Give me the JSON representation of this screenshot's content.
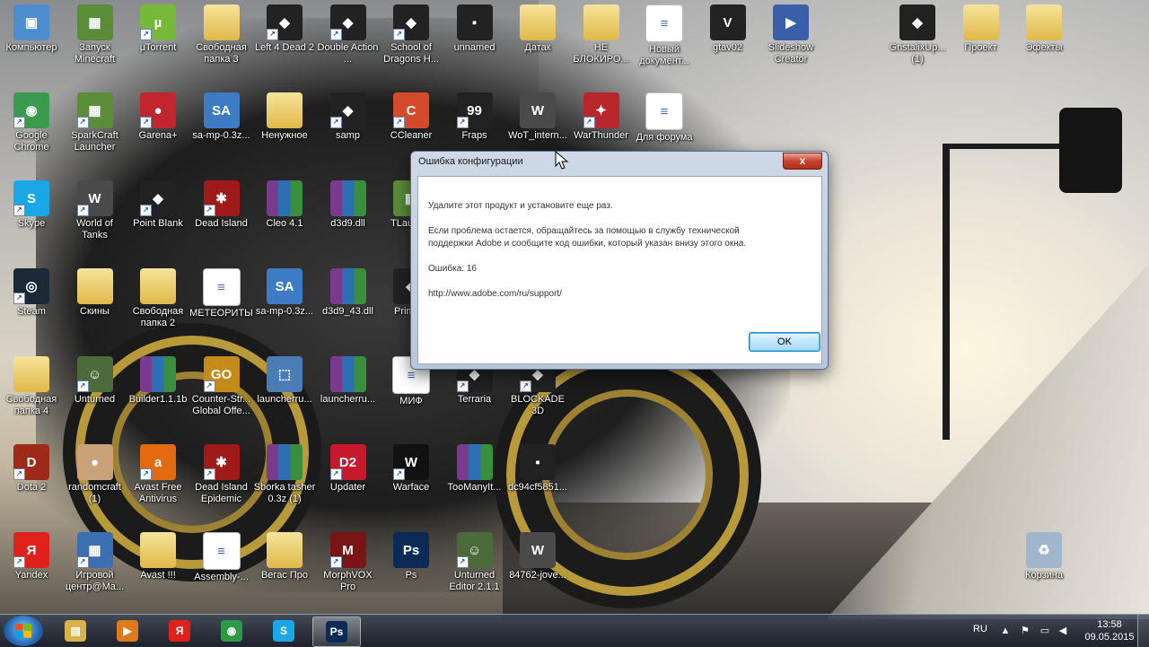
{
  "desktop": {
    "icons": [
      {
        "label": "Компьютер",
        "col": 0,
        "row": 0,
        "kind": "computer",
        "shortcut": false
      },
      {
        "label": "Запуск Minecraft",
        "col": 1,
        "row": 0,
        "kind": "minecraft",
        "shortcut": false
      },
      {
        "label": "µTorrent",
        "col": 2,
        "row": 0,
        "kind": "utorrent",
        "shortcut": true
      },
      {
        "label": "Свободная папка 3",
        "col": 3,
        "row": 0,
        "kind": "folder",
        "shortcut": false
      },
      {
        "label": "Left 4 Dead 2",
        "col": 4,
        "row": 0,
        "kind": "game-dark",
        "shortcut": true
      },
      {
        "label": "Double Action ...",
        "col": 5,
        "row": 0,
        "kind": "game-dark",
        "shortcut": true
      },
      {
        "label": "School of Dragons H...",
        "col": 6,
        "row": 0,
        "kind": "game-dark",
        "shortcut": true
      },
      {
        "label": "unnamed",
        "col": 7,
        "row": 0,
        "kind": "image",
        "shortcut": false
      },
      {
        "label": "Датак",
        "col": 8,
        "row": 0,
        "kind": "folder",
        "shortcut": false
      },
      {
        "label": "НЕ БЛОКИРО...",
        "col": 9,
        "row": 0,
        "kind": "folder",
        "shortcut": false
      },
      {
        "label": "Новый документ...",
        "col": 10,
        "row": 0,
        "kind": "doc",
        "shortcut": false
      },
      {
        "label": "gtav02",
        "col": 11,
        "row": 0,
        "kind": "gta",
        "shortcut": false
      },
      {
        "label": "Slideshow Creator",
        "col": 12,
        "row": 0,
        "kind": "slideshow",
        "shortcut": false
      },
      {
        "label": "GristalixUp... (1)",
        "col": 14,
        "row": 0,
        "kind": "game-dark",
        "shortcut": false
      },
      {
        "label": "Проект",
        "col": 15,
        "row": 0,
        "kind": "folder",
        "shortcut": false
      },
      {
        "label": "Эфекты",
        "col": 16,
        "row": 0,
        "kind": "folder",
        "shortcut": false
      },
      {
        "label": "Google Chrome",
        "col": 0,
        "row": 1,
        "kind": "chrome",
        "shortcut": true
      },
      {
        "label": "SparkCraft Launcher",
        "col": 1,
        "row": 1,
        "kind": "minecraft",
        "shortcut": true
      },
      {
        "label": "Garena+",
        "col": 2,
        "row": 1,
        "kind": "garena",
        "shortcut": true
      },
      {
        "label": "sa-mp-0.3z...",
        "col": 3,
        "row": 1,
        "kind": "samp",
        "shortcut": false
      },
      {
        "label": "Ненужное",
        "col": 4,
        "row": 1,
        "kind": "folder",
        "shortcut": false
      },
      {
        "label": "samp",
        "col": 5,
        "row": 1,
        "kind": "game-dark",
        "shortcut": true
      },
      {
        "label": "CCleaner",
        "col": 6,
        "row": 1,
        "kind": "ccleaner",
        "shortcut": true
      },
      {
        "label": "Fraps",
        "col": 7,
        "row": 1,
        "kind": "fraps",
        "shortcut": true
      },
      {
        "label": "WoT_intern...",
        "col": 8,
        "row": 1,
        "kind": "wot",
        "shortcut": false
      },
      {
        "label": "WarThunder",
        "col": 9,
        "row": 1,
        "kind": "warthunder",
        "shortcut": true
      },
      {
        "label": "Для форума",
        "col": 10,
        "row": 1,
        "kind": "doc",
        "shortcut": false
      },
      {
        "label": "Skype",
        "col": 0,
        "row": 2,
        "kind": "skype",
        "shortcut": true
      },
      {
        "label": "World of Tanks",
        "col": 1,
        "row": 2,
        "kind": "wot",
        "shortcut": true
      },
      {
        "label": "Point Blank",
        "col": 2,
        "row": 2,
        "kind": "game-dark",
        "shortcut": true
      },
      {
        "label": "Dead Island",
        "col": 3,
        "row": 2,
        "kind": "deadisland",
        "shortcut": true
      },
      {
        "label": "Cleo 4.1",
        "col": 4,
        "row": 2,
        "kind": "rar",
        "shortcut": false
      },
      {
        "label": "d3d9.dll",
        "col": 5,
        "row": 2,
        "kind": "rar",
        "shortcut": false
      },
      {
        "label": "TLaunc...",
        "col": 6,
        "row": 2,
        "kind": "minecraft",
        "shortcut": false
      },
      {
        "label": "Steam",
        "col": 0,
        "row": 3,
        "kind": "steam",
        "shortcut": true
      },
      {
        "label": "Скины",
        "col": 1,
        "row": 3,
        "kind": "folder",
        "shortcut": false
      },
      {
        "label": "Свободная папка 2",
        "col": 2,
        "row": 3,
        "kind": "folder",
        "shortcut": false
      },
      {
        "label": "МЕТЕОРИТЫ",
        "col": 3,
        "row": 3,
        "kind": "doc",
        "shortcut": false
      },
      {
        "label": "sa-mp-0.3z...",
        "col": 4,
        "row": 3,
        "kind": "samp",
        "shortcut": false
      },
      {
        "label": "d3d9_43.dll",
        "col": 5,
        "row": 3,
        "kind": "rar",
        "shortcut": false
      },
      {
        "label": "Prime...",
        "col": 6,
        "row": 3,
        "kind": "game-dark",
        "shortcut": false
      },
      {
        "label": "Свободная папка 4",
        "col": 0,
        "row": 4,
        "kind": "folder",
        "shortcut": false
      },
      {
        "label": "Unturned",
        "col": 1,
        "row": 4,
        "kind": "unturned",
        "shortcut": true
      },
      {
        "label": "Builder1.1.1b",
        "col": 2,
        "row": 4,
        "kind": "rar",
        "shortcut": false
      },
      {
        "label": "Counter-Str... Global Offe...",
        "col": 3,
        "row": 4,
        "kind": "csgo",
        "shortcut": true
      },
      {
        "label": "launcherru...",
        "col": 4,
        "row": 4,
        "kind": "launcher",
        "shortcut": false
      },
      {
        "label": "launcherru...",
        "col": 5,
        "row": 4,
        "kind": "rar",
        "shortcut": false
      },
      {
        "label": "МИФ",
        "col": 6,
        "row": 4,
        "kind": "doc",
        "shortcut": false
      },
      {
        "label": "Terraria",
        "col": 7,
        "row": 4,
        "kind": "game-dark",
        "shortcut": true
      },
      {
        "label": "BLOCKADE 3D",
        "col": 8,
        "row": 4,
        "kind": "game-dark",
        "shortcut": true
      },
      {
        "label": "Dota 2",
        "col": 0,
        "row": 5,
        "kind": "dota",
        "shortcut": true
      },
      {
        "label": "randomcraft (1)",
        "col": 1,
        "row": 5,
        "kind": "cake",
        "shortcut": false
      },
      {
        "label": "Avast Free Antivirus",
        "col": 2,
        "row": 5,
        "kind": "avast",
        "shortcut": true
      },
      {
        "label": "Dead Island Epidemic",
        "col": 3,
        "row": 5,
        "kind": "deadisland",
        "shortcut": true
      },
      {
        "label": "Sborka tasher 0.3z (1)",
        "col": 4,
        "row": 5,
        "kind": "rar",
        "shortcut": false
      },
      {
        "label": "Updater",
        "col": 5,
        "row": 5,
        "kind": "d2",
        "shortcut": true
      },
      {
        "label": "Warface",
        "col": 6,
        "row": 5,
        "kind": "warface",
        "shortcut": true
      },
      {
        "label": "TooManyIt...",
        "col": 7,
        "row": 5,
        "kind": "rar",
        "shortcut": false
      },
      {
        "label": "dc94cf5851...",
        "col": 8,
        "row": 5,
        "kind": "image",
        "shortcut": false
      },
      {
        "label": "Yandex",
        "col": 0,
        "row": 6,
        "kind": "yandex",
        "shortcut": true
      },
      {
        "label": "Игровой центр@Ma...",
        "col": 1,
        "row": 6,
        "kind": "gamecenter",
        "shortcut": true
      },
      {
        "label": "Avast !!!",
        "col": 2,
        "row": 6,
        "kind": "folder",
        "shortcut": false
      },
      {
        "label": "Assembly-...",
        "col": 3,
        "row": 6,
        "kind": "doc",
        "shortcut": false
      },
      {
        "label": "Вегас Про",
        "col": 4,
        "row": 6,
        "kind": "folder",
        "shortcut": false
      },
      {
        "label": "MorphVOX Pro",
        "col": 5,
        "row": 6,
        "kind": "morphvox",
        "shortcut": true
      },
      {
        "label": "Ps",
        "col": 6,
        "row": 6,
        "kind": "photoshop",
        "shortcut": false
      },
      {
        "label": "Unturned Editor 2.1.1",
        "col": 7,
        "row": 6,
        "kind": "unturned",
        "shortcut": true
      },
      {
        "label": "84762-jove...",
        "col": 8,
        "row": 6,
        "kind": "wot",
        "shortcut": false
      },
      {
        "label": "Корзина",
        "col": 16,
        "row": 6,
        "kind": "recycle",
        "shortcut": false
      }
    ]
  },
  "dialog": {
    "title": "Ошибка конфигурации",
    "close_label": "x",
    "line1": "Удалите этот продукт и установите еще раз.",
    "line2": "Если проблема остается, обращайтесь за помощью в службу технической",
    "line3": "поддержки Adobe и сообщите код ошибки, который указан внизу этого окна.",
    "error_code": "Ошибка: 16",
    "url": "http://www.adobe.com/ru/support/",
    "ok_label": "OK"
  },
  "taskbar": {
    "buttons": [
      {
        "name": "explorer",
        "glyph": "▤",
        "color": "#d9b24a"
      },
      {
        "name": "media-player",
        "glyph": "▶",
        "color": "#e07a1f"
      },
      {
        "name": "yandex",
        "glyph": "Я",
        "color": "#e0211b"
      },
      {
        "name": "chrome",
        "glyph": "◉",
        "color": "#2e9a48"
      },
      {
        "name": "skype",
        "glyph": "S",
        "color": "#1aa7e8"
      },
      {
        "name": "photoshop",
        "glyph": "Ps",
        "color": "#0b2a55"
      }
    ],
    "active_button": "photoshop",
    "language": "RU",
    "time": "13:58",
    "date": "09.05.2015"
  }
}
